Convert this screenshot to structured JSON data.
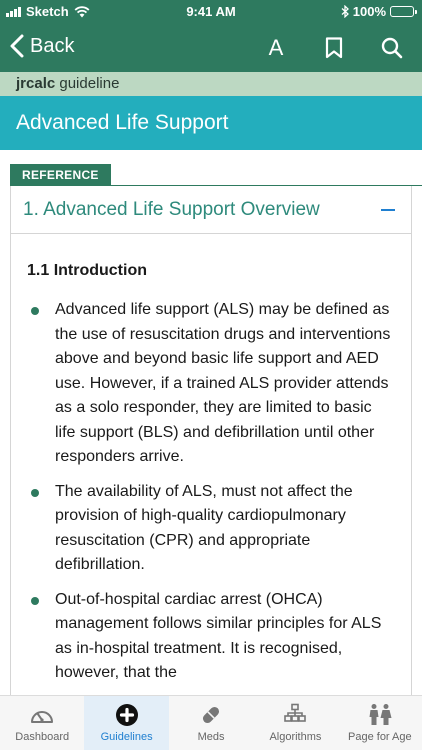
{
  "status_bar": {
    "carrier": "Sketch",
    "time": "9:41 AM",
    "battery": "100%"
  },
  "nav": {
    "back_label": "Back",
    "text_size_label": "A"
  },
  "brand": {
    "name_bold": "jrcalc",
    "name_rest": " guideline"
  },
  "page": {
    "title": "Advanced Life Support"
  },
  "reference_tag": "REFERENCE",
  "section": {
    "title": "1. Advanced Life Support Overview",
    "subheading": "1.1 Introduction",
    "bullets": [
      "Advanced life support (ALS) may be defined as the use of resuscitation drugs and interventions above and beyond basic life support and AED use. However, if a trained ALS provider attends as a solo responder, they are limited to basic life support (BLS) and defibrillation until other responders arrive.",
      "The availability of ALS, must not affect the provision of high-quality cardiopulmonary resuscitation (CPR) and appropriate defibrillation.",
      "Out-of-hospital cardiac arrest (OHCA) management follows similar principles for ALS as in-hospital treatment. It is recognised, however, that the"
    ]
  },
  "tabs": [
    {
      "label": "Dashboard",
      "icon": "dashboard-icon"
    },
    {
      "label": "Guidelines",
      "icon": "guidelines-icon"
    },
    {
      "label": "Meds",
      "icon": "meds-icon"
    },
    {
      "label": "Algorithms",
      "icon": "algorithms-icon"
    },
    {
      "label": "Page for Age",
      "icon": "page-for-age-icon"
    }
  ],
  "colors": {
    "header_green": "#2e7a5f",
    "brand_strip": "#bcd8c2",
    "title_teal": "#23aebd",
    "section_title": "#2e8a7c",
    "tab_active": "#1f7fd0"
  }
}
